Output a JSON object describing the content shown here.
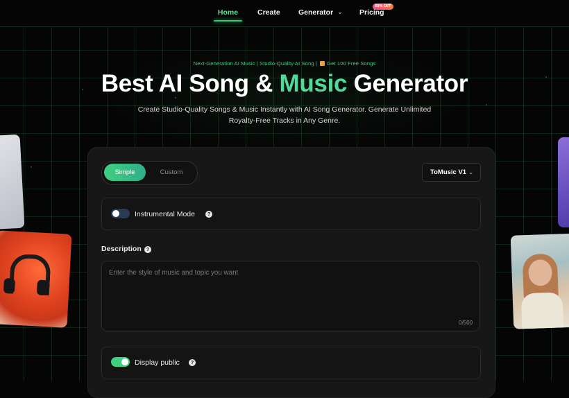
{
  "nav": {
    "items": [
      {
        "label": "Home"
      },
      {
        "label": "Create"
      },
      {
        "label": "Generator"
      },
      {
        "label": "Pricing"
      }
    ],
    "pricing_badge": "68% OFF"
  },
  "hero": {
    "tagline_part1": "Next-Generation AI Music | Studio-Quality AI Song |",
    "tagline_part2": "Get 100 Free Songs",
    "title_part1": "Best AI Song & ",
    "title_accent": "Music",
    "title_part2": " Generator",
    "subtitle": "Create Studio-Quality Songs & Music Instantly with AI Song Generator. Generate Unlimited Royalty-Free Tracks in Any Genre."
  },
  "form": {
    "modes": [
      "Simple",
      "Custom"
    ],
    "active_mode": "Simple",
    "model": "ToMusic V1",
    "instrumental_label": "Instrumental Mode",
    "instrumental_on": false,
    "description_label": "Description",
    "description_placeholder": "Enter the style of music and topic you want",
    "description_counter": "0/500",
    "display_public_label": "Display public",
    "display_public_on": true
  },
  "colors": {
    "accent": "#3fd07f",
    "background": "#050505",
    "panel": "#171717"
  }
}
